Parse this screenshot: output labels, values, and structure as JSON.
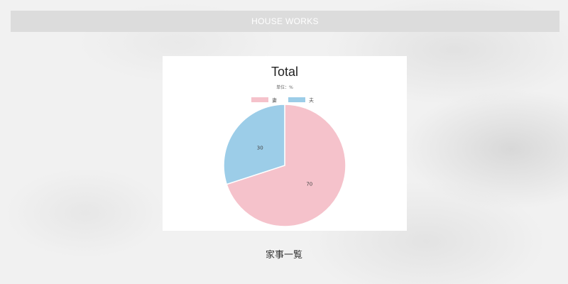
{
  "header": {
    "title": "HOUSE WORKS"
  },
  "colors": {
    "wife": "#f5c2cb",
    "husband": "#9ccde8"
  },
  "chart_data": {
    "type": "pie",
    "title": "Total",
    "subtitle": "単位：%",
    "labels": [
      "妻",
      "夫"
    ],
    "values": [
      70,
      30
    ],
    "legend": "top"
  },
  "section": {
    "title": "家事一覧"
  }
}
